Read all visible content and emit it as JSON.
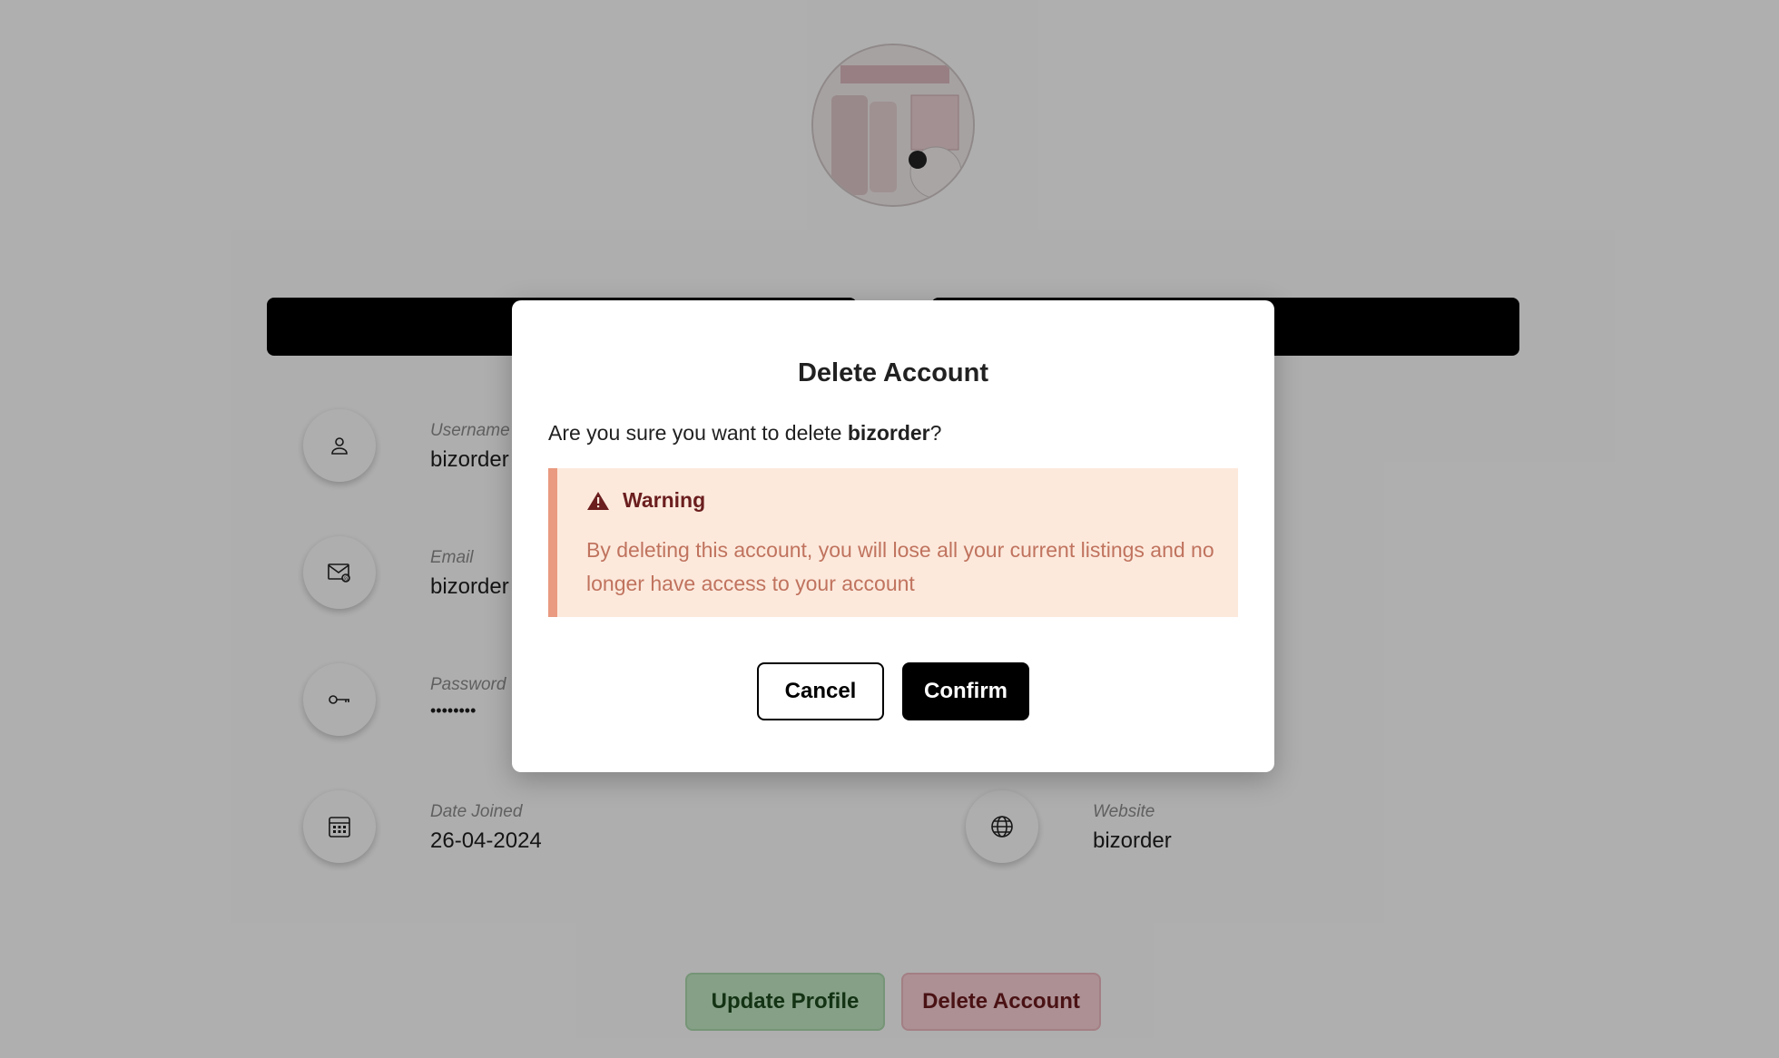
{
  "profile": {
    "fields_left": [
      {
        "label": "Username",
        "value": "bizorder",
        "icon": "user-icon"
      },
      {
        "label": "Email",
        "value": "bizorder",
        "icon": "email-icon"
      },
      {
        "label": "Password",
        "value": "••••••••",
        "icon": "key-icon"
      },
      {
        "label": "Date Joined",
        "value": "26-04-2024",
        "icon": "calendar-icon"
      }
    ],
    "fields_right": [
      {
        "label": "Website",
        "value": "bizorder",
        "icon": "globe-icon"
      }
    ],
    "update_button": "Update Profile",
    "delete_button": "Delete Account"
  },
  "modal": {
    "title": "Delete Account",
    "question_prefix": "Are you sure you want to delete ",
    "question_name": "bizorder",
    "question_suffix": "?",
    "warning_title": "Warning",
    "warning_text": "By deleting this account, you will lose all your current listings and no longer have access to your account",
    "cancel_label": "Cancel",
    "confirm_label": "Confirm"
  },
  "colors": {
    "warning_bg": "#fce9dc",
    "warning_border": "#e99a80",
    "warning_text": "#c0735e",
    "warning_title": "#6b1e1e",
    "confirm_bg": "#000000"
  }
}
